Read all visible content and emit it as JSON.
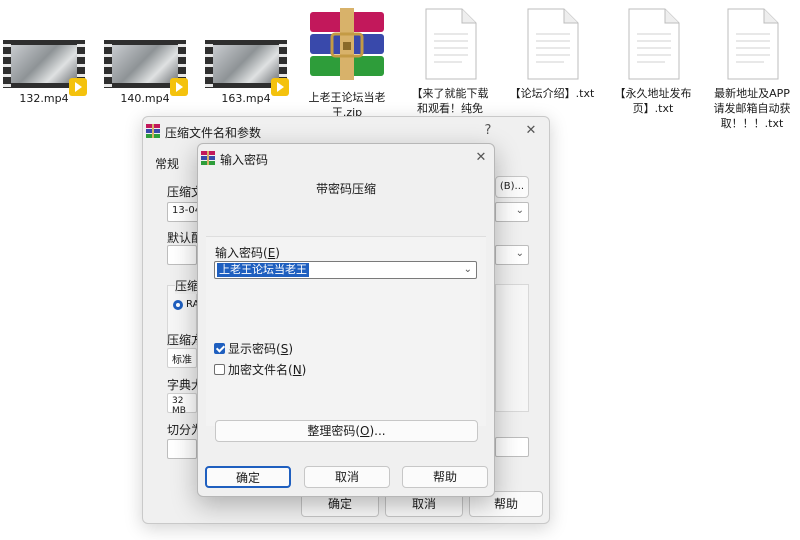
{
  "desktop": {
    "files": [
      {
        "name": "132.mp4",
        "kind": "video"
      },
      {
        "name": "140.mp4",
        "kind": "video"
      },
      {
        "name": "163.mp4",
        "kind": "video"
      },
      {
        "name": "上老王论坛当老王.zip",
        "kind": "winrar-archive"
      },
      {
        "name": "【来了就能下载和观看！纯免",
        "kind": "text"
      },
      {
        "name": "【论坛介绍】.txt",
        "kind": "text"
      },
      {
        "name": "【永久地址发布页】.txt",
        "kind": "text"
      },
      {
        "name": "最新地址及APP请发邮箱自动获取！！！.txt",
        "kind": "text"
      }
    ]
  },
  "back_window": {
    "title": "压缩文件名和参数",
    "help_btn": "?",
    "close_btn": "✕",
    "tab_general": "常规",
    "label_archive_name": "压缩文",
    "archive_name_value": "13-04",
    "browse_btn": "(B)...",
    "label_default": "默认配",
    "group_format": "压缩",
    "format_rar": "RA",
    "label_method": "压缩方",
    "method_value": "标准",
    "label_dict": "字典大",
    "dict_value": "32 MB",
    "label_split": "切分为",
    "ok_btn": "确定",
    "cancel_btn": "取消",
    "help_label": "帮助"
  },
  "dialog": {
    "title": "输入密码",
    "close_btn": "✕",
    "heading": "带密码压缩",
    "password_label": "输入密码(",
    "password_label_key": "E",
    "password_label_end": ")",
    "password_value": "上老王论坛当老王",
    "show_password": "显示密码(",
    "show_password_key": "S",
    "show_password_checked": true,
    "encrypt_names": "加密文件名(",
    "encrypt_names_key": "N",
    "encrypt_names_checked": false,
    "organize_btn": "整理密码(",
    "organize_btn_key": "O",
    "organize_btn_end": ")...",
    "ok_btn": "确定",
    "cancel_btn": "取消",
    "help_btn": "帮助"
  },
  "colors": {
    "accent": "#1f5fbf",
    "dialog_bg": "#f0f0f0"
  }
}
